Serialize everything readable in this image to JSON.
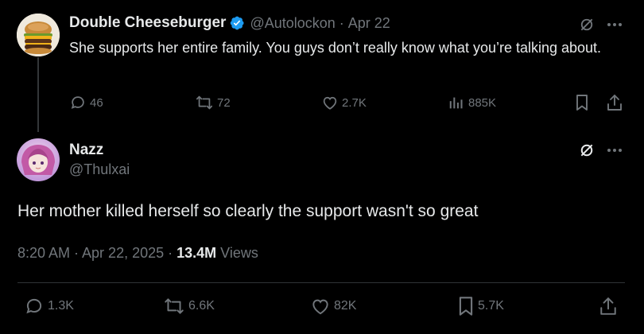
{
  "parent_tweet": {
    "author_name": "Double Cheeseburger",
    "verified": true,
    "handle": "@Autolockon",
    "separator": "·",
    "date": "Apr 22",
    "text": "She supports her entire family. You guys don’t really know what you’re talking about.",
    "actions": {
      "replies": "46",
      "reposts": "72",
      "likes": "2.7K",
      "views": "885K"
    }
  },
  "main_tweet": {
    "author_name": "Nazz",
    "handle": "@Thulxai",
    "text": "Her mother killed herself so clearly the support wasn't so great",
    "timestamp": "8:20 AM · Apr 22, 2025 · ",
    "views_count": "13.4M",
    "views_label": " Views",
    "actions": {
      "replies": "1.3K",
      "reposts": "6.6K",
      "likes": "82K",
      "bookmarks": "5.7K"
    }
  },
  "colors": {
    "background": "#000000",
    "text": "#e7e9ea",
    "muted": "#71767b",
    "verified": "#1d9bf0",
    "divider": "#2f3336"
  },
  "icons": [
    "verified-badge-icon",
    "grok-icon",
    "more-icon",
    "reply-icon",
    "repost-icon",
    "like-icon",
    "views-icon",
    "bookmark-icon",
    "share-icon"
  ]
}
